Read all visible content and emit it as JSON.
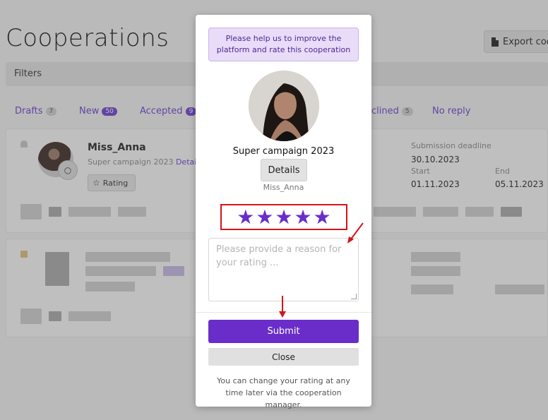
{
  "page": {
    "title": "Cooperations",
    "export_label": "Export coo",
    "filters_label": "Filters"
  },
  "tabs": [
    {
      "label": "Drafts",
      "count": "7"
    },
    {
      "label": "New",
      "count": "50"
    },
    {
      "label": "Accepted",
      "count": "9"
    },
    {
      "label": "clined",
      "count": "5"
    },
    {
      "label": "No reply",
      "count": ""
    }
  ],
  "card": {
    "name": "Miss_Anna",
    "campaign": "Super campaign 2023",
    "details_link": "Details",
    "rating_label": "Rating",
    "submission_label": "Submission deadline",
    "submission_value": "30.10.2023",
    "start_label": "Start",
    "start_value": "01.11.2023",
    "end_label": "End",
    "end_value": "05.11.2023"
  },
  "modal": {
    "notice": "Please help us to improve the platform and rate this cooperation",
    "campaign": "Super campaign 2023",
    "details_label": "Details",
    "name": "Miss_Anna",
    "rating_stars": 5,
    "rating_max": 5,
    "reason_placeholder": "Please provide a reason for your rating ...",
    "submit_label": "Submit",
    "close_label": "Close",
    "footer_note": "You can change your rating at any time later via the cooperation manager."
  },
  "colors": {
    "accent": "#6a2dc9",
    "highlight_red": "#d3141c",
    "notice_bg": "#e8dcf8"
  }
}
